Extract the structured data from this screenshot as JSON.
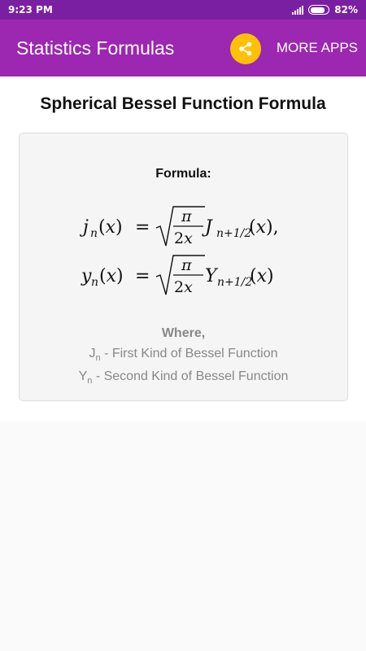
{
  "status": {
    "time": "9:23 PM",
    "battery": "82%",
    "battery_level": 0.82
  },
  "appbar": {
    "title": "Statistics Formulas",
    "more_apps": "MORE APPS"
  },
  "page": {
    "title": "Spherical Bessel Function Formula",
    "formula_label": "Formula:",
    "where_label": "Where,",
    "definitions": [
      {
        "symbol": "J",
        "subscript": "n",
        "text": " - First Kind of Bessel Function"
      },
      {
        "symbol": "Y",
        "subscript": "n",
        "text": " - Second Kind of Bessel Function"
      }
    ]
  },
  "colors": {
    "statusbar": "#7b1fa2",
    "appbar": "#9c27b0",
    "share": "#ffc107"
  }
}
